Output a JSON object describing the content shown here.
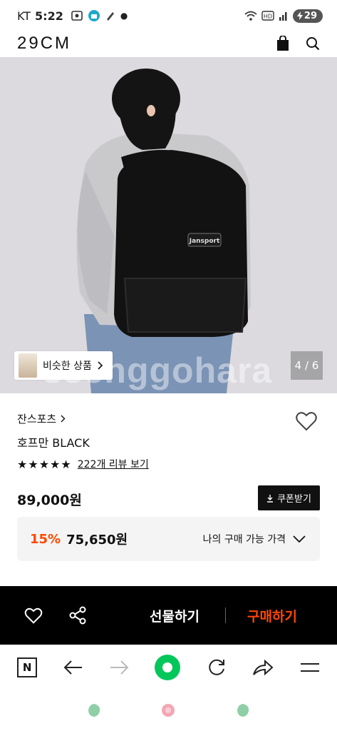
{
  "status_bar": {
    "carrier": "KT",
    "time": "5:22",
    "battery": "29"
  },
  "header": {
    "logo": "29CM",
    "icons": [
      "shopping-bag-icon",
      "search-icon"
    ]
  },
  "hero": {
    "watermark": "ssenggohara",
    "similar_label": "비슷한 상품",
    "counter": "4 / 6",
    "image_current": 4,
    "image_total": 6
  },
  "product": {
    "brand": "잔스포츠",
    "name": "호프만 BLACK",
    "star_rating": 5,
    "reviews": "222개 리뷰 보기",
    "price": "89,000원",
    "coupon_label": "쿠폰받기",
    "discount_rate": "15%",
    "discount_price": "75,650원",
    "my_price_label": "나의 구매 가능 가격"
  },
  "buy_bar": {
    "gift_label": "선물하기",
    "buy_label": "구매하기",
    "accent": "#ff4800"
  },
  "browser_bar": {
    "n_label": "N",
    "green": "#03c75a"
  }
}
